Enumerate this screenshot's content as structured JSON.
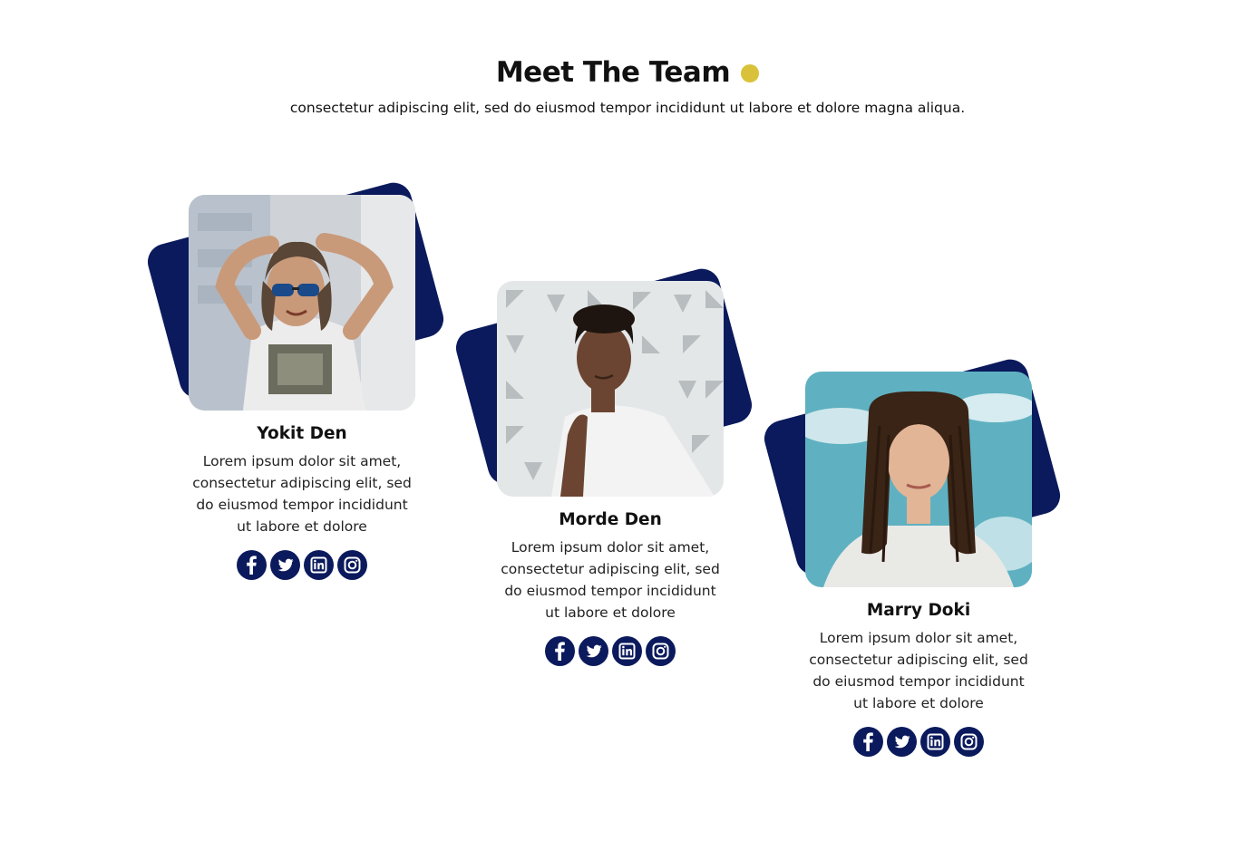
{
  "header": {
    "title": "Meet The Team",
    "subtitle": "consectetur adipiscing elit, sed do eiusmod tempor incididunt ut labore et dolore magna aliqua."
  },
  "colors": {
    "accent_dot": "#d9c23a",
    "navy": "#0b1a5c",
    "text": "#111111"
  },
  "members": [
    {
      "name": "Yokit Den",
      "bio": "Lorem ipsum dolor sit amet, consectetur adipiscing elit, sed do eiusmod tempor incididunt ut labore et dolore",
      "photo": "man-with-sunglasses-photo",
      "socials": [
        "facebook-icon",
        "twitter-icon",
        "linkedin-icon",
        "instagram-icon"
      ]
    },
    {
      "name": "Morde Den",
      "bio": "Lorem ipsum dolor sit amet, consectetur adipiscing elit, sed do eiusmod tempor incididunt ut labore et dolore",
      "photo": "man-white-tshirt-photo",
      "socials": [
        "facebook-icon",
        "twitter-icon",
        "linkedin-icon",
        "instagram-icon"
      ]
    },
    {
      "name": "Marry Doki",
      "bio": "Lorem ipsum dolor sit amet, consectetur adipiscing elit, sed do eiusmod tempor incididunt ut labore et dolore",
      "photo": "woman-braids-photo",
      "socials": [
        "facebook-icon",
        "twitter-icon",
        "linkedin-icon",
        "instagram-icon"
      ]
    }
  ]
}
